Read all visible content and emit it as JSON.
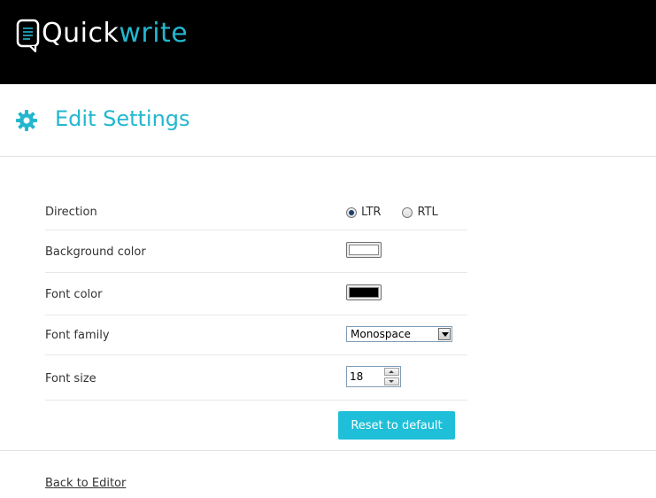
{
  "app": {
    "logo_white": "Quick",
    "logo_cyan": "write",
    "brand_color": "#23b7cf",
    "logo_icon": "speech-bubble-icon"
  },
  "page": {
    "title": "Edit Settings",
    "title_icon": "gear-icon"
  },
  "settings": {
    "direction": {
      "label": "Direction",
      "options": [
        "LTR",
        "RTL"
      ],
      "selected": "LTR"
    },
    "background_color": {
      "label": "Background color",
      "value": "#ffffff"
    },
    "font_color": {
      "label": "Font color",
      "value": "#000000"
    },
    "font_family": {
      "label": "Font family",
      "value": "Monospace"
    },
    "font_size": {
      "label": "Font size",
      "value": "18"
    }
  },
  "actions": {
    "reset_label": "Reset to default",
    "reset_color": "#1fbfd9",
    "back_label": "Back to Editor"
  }
}
